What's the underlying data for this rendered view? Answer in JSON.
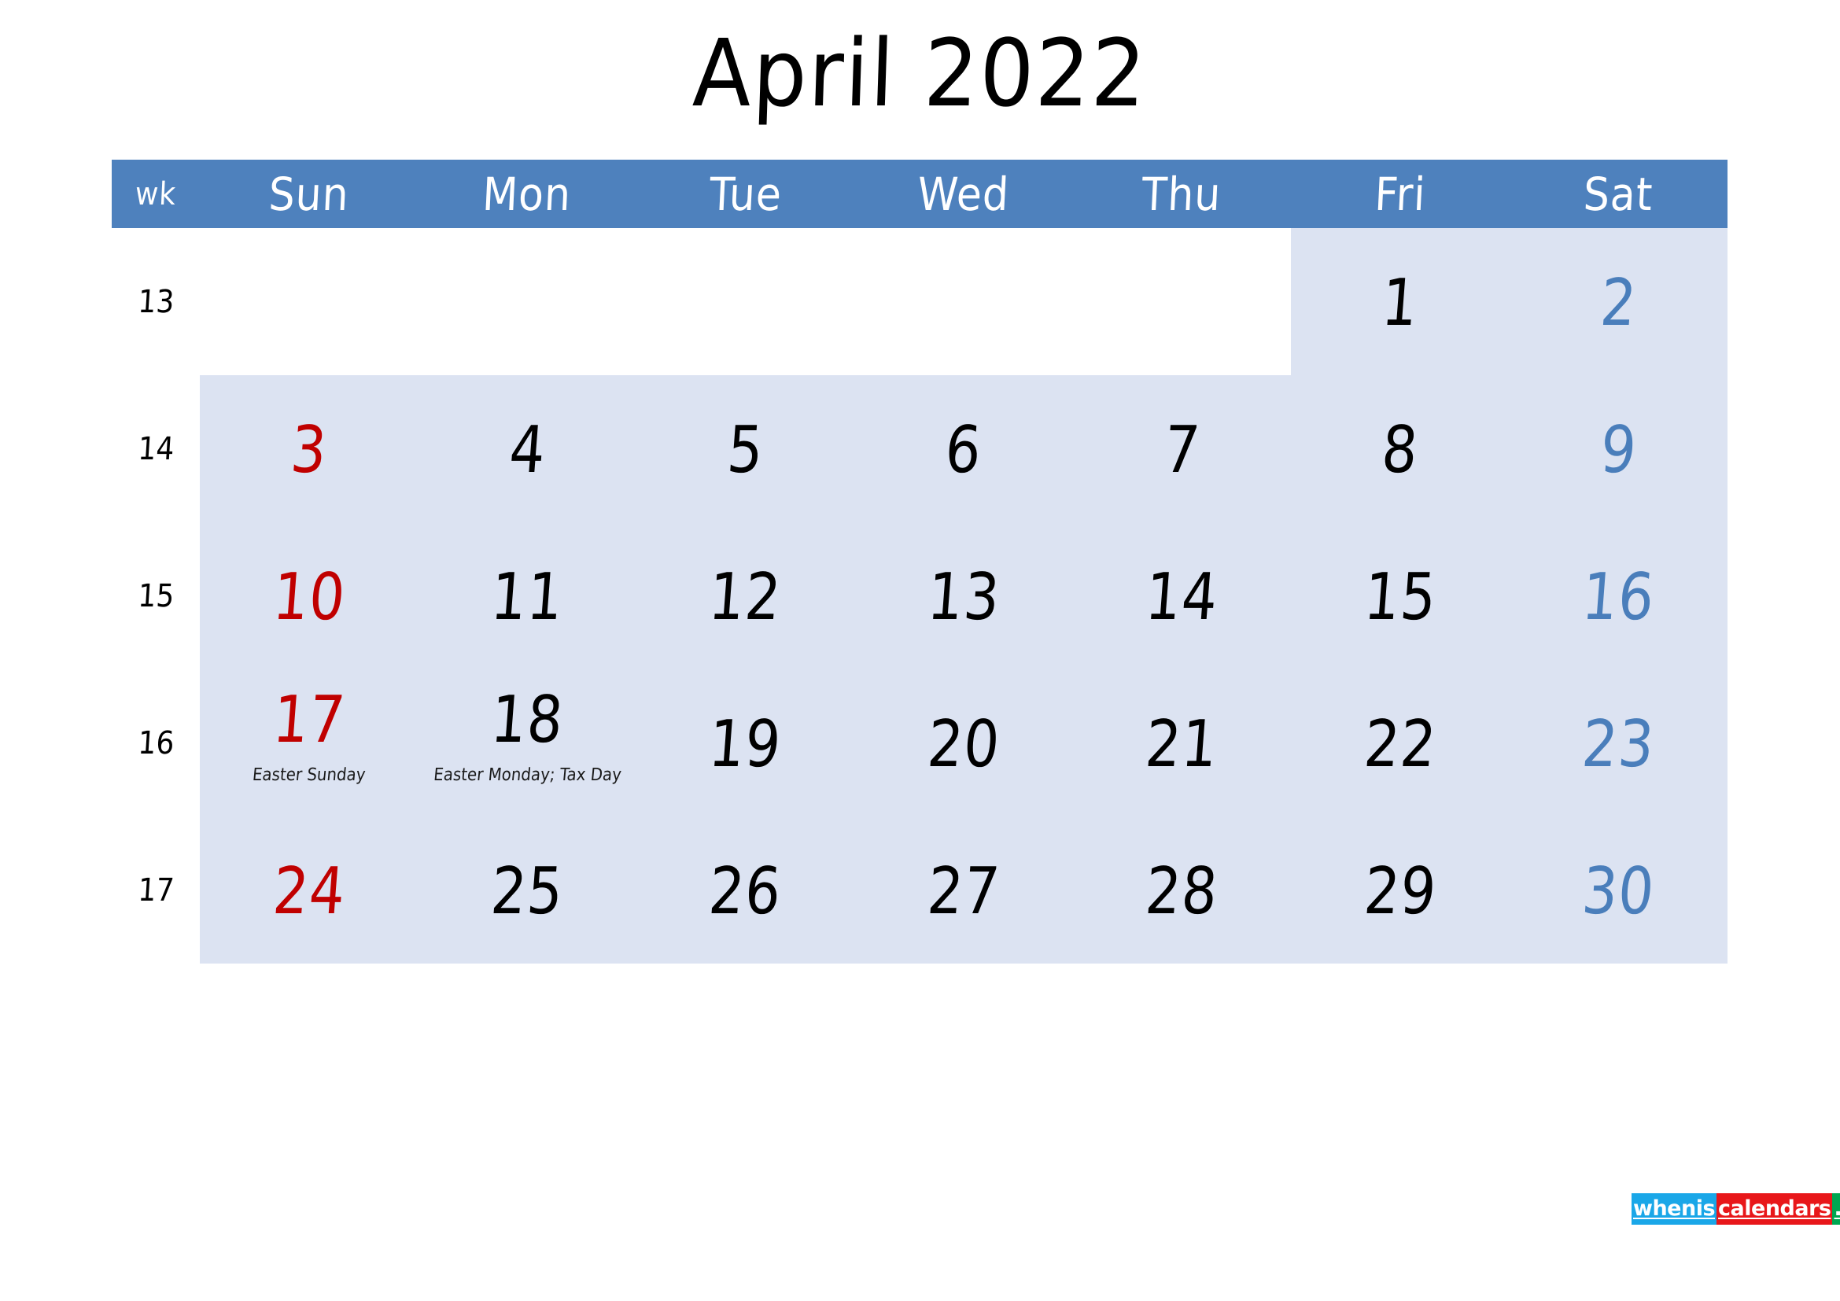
{
  "title": "April 2022",
  "colors": {
    "header_bg": "#4e81bd",
    "header_text": "#ffffff",
    "body_shaded": "#dce3f2",
    "body_plain": "#ffffff",
    "sunday": "#c00000",
    "saturday": "#4a7ebb",
    "weekday": "#000000"
  },
  "header": {
    "wk_label": "wk",
    "days": [
      "Sun",
      "Mon",
      "Tue",
      "Wed",
      "Thu",
      "Fri",
      "Sat"
    ]
  },
  "weeks": [
    {
      "wk": "13",
      "days": [
        {
          "num": "",
          "kind": "sun",
          "shaded": false,
          "event": ""
        },
        {
          "num": "",
          "kind": "weekday",
          "shaded": false,
          "event": ""
        },
        {
          "num": "",
          "kind": "weekday",
          "shaded": false,
          "event": ""
        },
        {
          "num": "",
          "kind": "weekday",
          "shaded": false,
          "event": ""
        },
        {
          "num": "",
          "kind": "weekday",
          "shaded": false,
          "event": ""
        },
        {
          "num": "1",
          "kind": "weekday",
          "shaded": true,
          "event": ""
        },
        {
          "num": "2",
          "kind": "sat",
          "shaded": true,
          "event": ""
        }
      ]
    },
    {
      "wk": "14",
      "days": [
        {
          "num": "3",
          "kind": "sun",
          "shaded": true,
          "event": ""
        },
        {
          "num": "4",
          "kind": "weekday",
          "shaded": true,
          "event": ""
        },
        {
          "num": "5",
          "kind": "weekday",
          "shaded": true,
          "event": ""
        },
        {
          "num": "6",
          "kind": "weekday",
          "shaded": true,
          "event": ""
        },
        {
          "num": "7",
          "kind": "weekday",
          "shaded": true,
          "event": ""
        },
        {
          "num": "8",
          "kind": "weekday",
          "shaded": true,
          "event": ""
        },
        {
          "num": "9",
          "kind": "sat",
          "shaded": true,
          "event": ""
        }
      ]
    },
    {
      "wk": "15",
      "days": [
        {
          "num": "10",
          "kind": "sun",
          "shaded": true,
          "event": ""
        },
        {
          "num": "11",
          "kind": "weekday",
          "shaded": true,
          "event": ""
        },
        {
          "num": "12",
          "kind": "weekday",
          "shaded": true,
          "event": ""
        },
        {
          "num": "13",
          "kind": "weekday",
          "shaded": true,
          "event": ""
        },
        {
          "num": "14",
          "kind": "weekday",
          "shaded": true,
          "event": ""
        },
        {
          "num": "15",
          "kind": "weekday",
          "shaded": true,
          "event": ""
        },
        {
          "num": "16",
          "kind": "sat",
          "shaded": true,
          "event": ""
        }
      ]
    },
    {
      "wk": "16",
      "days": [
        {
          "num": "17",
          "kind": "sun",
          "shaded": true,
          "event": "Easter Sunday"
        },
        {
          "num": "18",
          "kind": "weekday",
          "shaded": true,
          "event": "Easter Monday; Tax Day"
        },
        {
          "num": "19",
          "kind": "weekday",
          "shaded": true,
          "event": ""
        },
        {
          "num": "20",
          "kind": "weekday",
          "shaded": true,
          "event": ""
        },
        {
          "num": "21",
          "kind": "weekday",
          "shaded": true,
          "event": ""
        },
        {
          "num": "22",
          "kind": "weekday",
          "shaded": true,
          "event": ""
        },
        {
          "num": "23",
          "kind": "sat",
          "shaded": true,
          "event": ""
        }
      ]
    },
    {
      "wk": "17",
      "days": [
        {
          "num": "24",
          "kind": "sun",
          "shaded": true,
          "event": ""
        },
        {
          "num": "25",
          "kind": "weekday",
          "shaded": true,
          "event": ""
        },
        {
          "num": "26",
          "kind": "weekday",
          "shaded": true,
          "event": ""
        },
        {
          "num": "27",
          "kind": "weekday",
          "shaded": true,
          "event": ""
        },
        {
          "num": "28",
          "kind": "weekday",
          "shaded": true,
          "event": ""
        },
        {
          "num": "29",
          "kind": "weekday",
          "shaded": true,
          "event": ""
        },
        {
          "num": "30",
          "kind": "sat",
          "shaded": true,
          "event": ""
        }
      ]
    }
  ],
  "watermark": {
    "part1": "whenis",
    "part2": "calendars",
    "part3": ".com"
  }
}
